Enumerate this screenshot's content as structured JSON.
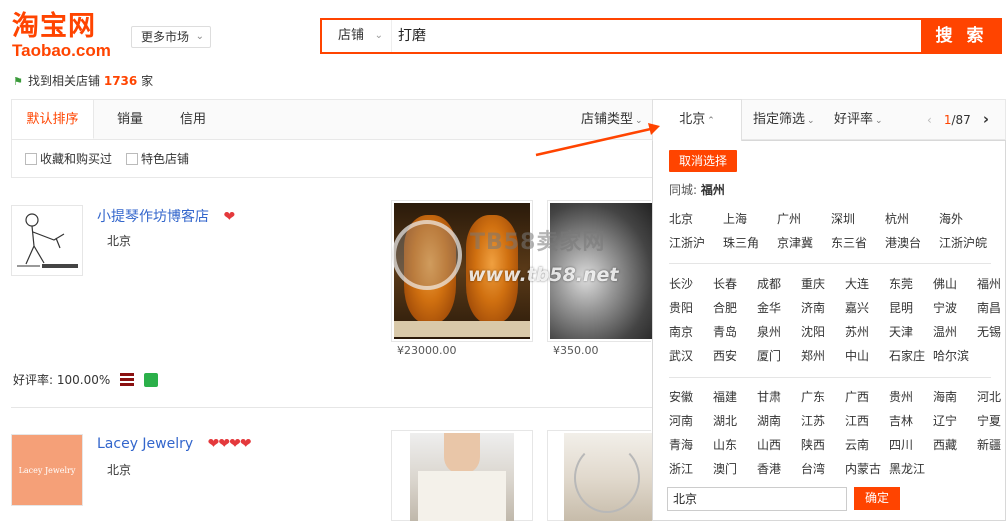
{
  "header": {
    "logo_cn": "淘宝网",
    "logo_en": "Taobao.com",
    "more_market": "更多市场",
    "search_scope": "店铺",
    "search_query": "打磨",
    "search_button": "搜 索"
  },
  "result": {
    "prefix": "找到相关店铺",
    "count": "1736",
    "suffix": "家"
  },
  "sortbar": {
    "default": "默认排序",
    "sales": "销量",
    "credit": "信用",
    "shop_type": "店铺类型",
    "city": "北京",
    "filter": "指定筛选",
    "rating": "好评率",
    "page_current": "1",
    "page_total": "/87"
  },
  "filters": {
    "collected": "收藏和购买过",
    "featured": "特色店铺"
  },
  "shops": [
    {
      "name": "小提琴作坊博客店",
      "location": "北京",
      "rating_label": "好评率: 100.00%",
      "products": [
        {
          "price": "¥23000.00"
        },
        {
          "price": "¥350.00"
        }
      ]
    },
    {
      "name": "Lacey Jewelry",
      "logo_text": "Lacey Jewelry",
      "location": "北京"
    }
  ],
  "watermark": {
    "line1": "TB58卖家网",
    "line2": "www.tb58.net"
  },
  "dropdown": {
    "cancel": "取消选择",
    "same_city_label": "同城:",
    "same_city_value": "福州",
    "row_hot": [
      "北京",
      "上海",
      "广州",
      "深圳",
      "杭州",
      "海外"
    ],
    "row_regions": [
      "江浙沪",
      "珠三角",
      "京津冀",
      "东三省",
      "港澳台",
      "江浙沪皖"
    ],
    "cities": [
      [
        "长沙",
        "长春",
        "成都",
        "重庆",
        "大连",
        "东莞",
        "佛山",
        "福州"
      ],
      [
        "贵阳",
        "合肥",
        "金华",
        "济南",
        "嘉兴",
        "昆明",
        "宁波",
        "南昌"
      ],
      [
        "南京",
        "青岛",
        "泉州",
        "沈阳",
        "苏州",
        "天津",
        "温州",
        "无锡"
      ],
      [
        "武汉",
        "西安",
        "厦门",
        "郑州",
        "中山",
        "石家庄",
        "哈尔滨"
      ]
    ],
    "provinces": [
      [
        "安徽",
        "福建",
        "甘肃",
        "广东",
        "广西",
        "贵州",
        "海南",
        "河北"
      ],
      [
        "河南",
        "湖北",
        "湖南",
        "江苏",
        "江西",
        "吉林",
        "辽宁",
        "宁夏"
      ],
      [
        "青海",
        "山东",
        "山西",
        "陕西",
        "云南",
        "四川",
        "西藏",
        "新疆"
      ],
      [
        "浙江",
        "澳门",
        "香港",
        "台湾",
        "内蒙古",
        "黑龙江"
      ]
    ],
    "input_value": "北京",
    "confirm": "确定"
  },
  "colors": {
    "brand": "#ff4400",
    "link": "#3366cc"
  }
}
